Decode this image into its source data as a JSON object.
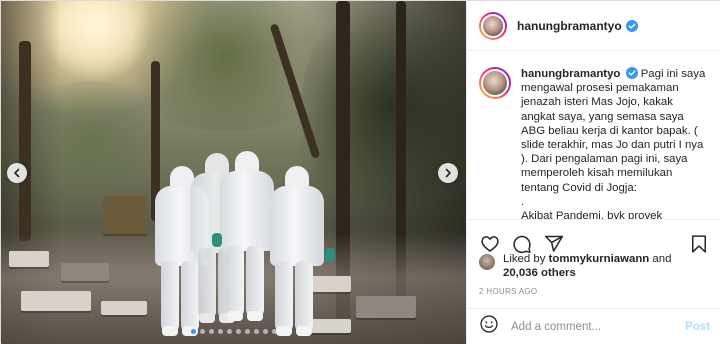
{
  "post": {
    "username": "hanungbramantyo",
    "verified": true,
    "media": {
      "slide_count": 10,
      "active_slide": 1
    }
  },
  "caption": {
    "username": "hanungbramantyo",
    "text": "Pagi ini saya mengawal prosesi pemakaman jenazah isteri Mas Jojo, kakak angkat saya, yang semasa saya ABG beliau kerja di kantor bapak. ( slide terakhir, mas Jo dan putri I nya ). Dari pengalaman pagi ini, saya memperoleh kisah memilukan tentang Covid di Jogja:\n.\nAkibat Pandemi, byk proyek jasaagan"
  },
  "actions": {
    "like_icon": "heart-outline-icon",
    "comment_icon": "speech-bubble-icon",
    "share_icon": "paper-plane-icon",
    "save_icon": "bookmark-icon"
  },
  "likes": {
    "prefix": "Liked by ",
    "user": "tommykurniawann",
    "middle": " and",
    "others": "20,036 others"
  },
  "timestamp": "2 HOURS AGO",
  "comment": {
    "placeholder": "Add a comment...",
    "post_label": "Post"
  },
  "colors": {
    "accent_blue": "#3897f0",
    "post_disabled": "#b2dffc",
    "border": "#dbdbdb",
    "muted_text": "#8e8e8e"
  }
}
